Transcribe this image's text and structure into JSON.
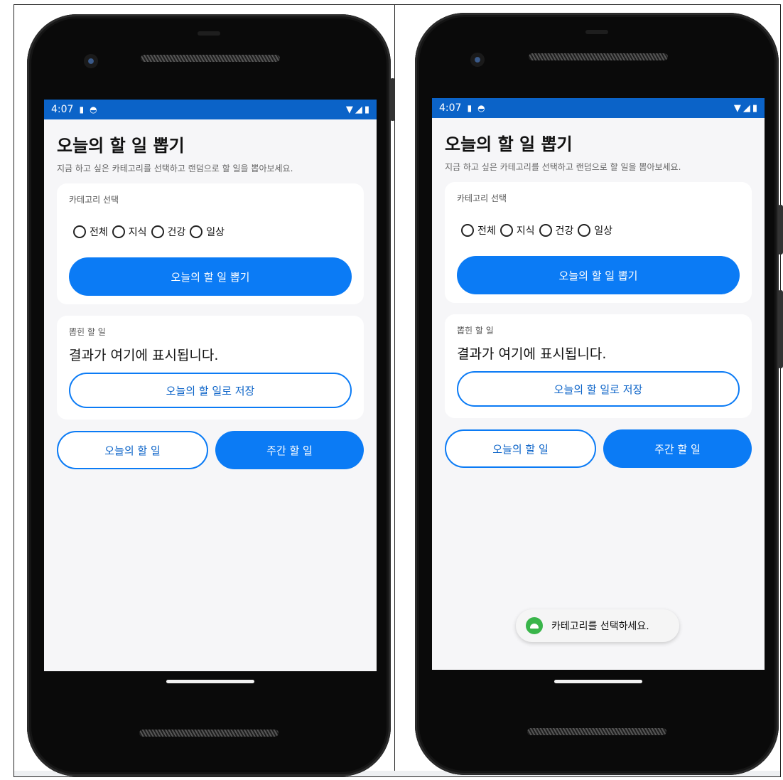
{
  "screens": [
    {
      "status_bar": {
        "time": "4:07"
      },
      "title": "오늘의 할 일 뽑기",
      "subtitle": "지금 하고 싶은 카테고리를 선택하고 랜덤으로 할 일을 뽑아보세요.",
      "category_card": {
        "label": "카테고리 선택",
        "options": [
          "전체",
          "지식",
          "건강",
          "일상"
        ],
        "draw_button": "오늘의 할 일 뽑기"
      },
      "result_card": {
        "label": "뽑힌 할 일",
        "result_text": "결과가 여기에 표시됩니다.",
        "save_button": "오늘의 할 일로 저장"
      },
      "bottom_buttons": {
        "today": "오늘의 할 일",
        "weekly": "주간 할 일"
      },
      "toast": null
    },
    {
      "status_bar": {
        "time": "4:07"
      },
      "title": "오늘의 할 일 뽑기",
      "subtitle": "지금 하고 싶은 카테고리를 선택하고 랜덤으로 할 일을 뽑아보세요.",
      "category_card": {
        "label": "카테고리 선택",
        "options": [
          "전체",
          "지식",
          "건강",
          "일상"
        ],
        "draw_button": "오늘의 할 일 뽑기"
      },
      "result_card": {
        "label": "뽑힌 할 일",
        "result_text": "결과가 여기에 표시됩니다.",
        "save_button": "오늘의 할 일로 저장"
      },
      "bottom_buttons": {
        "today": "오늘의 할 일",
        "weekly": "주간 할 일"
      },
      "toast": {
        "text": "카테고리를 선택하세요.",
        "icon": "android-icon"
      }
    }
  ],
  "colors": {
    "status_bar": "#0b63c8",
    "primary_button": "#0b7bf5",
    "screen_background": "#f6f6f8",
    "card_background": "#ffffff",
    "toast_icon": "#39b54a"
  }
}
